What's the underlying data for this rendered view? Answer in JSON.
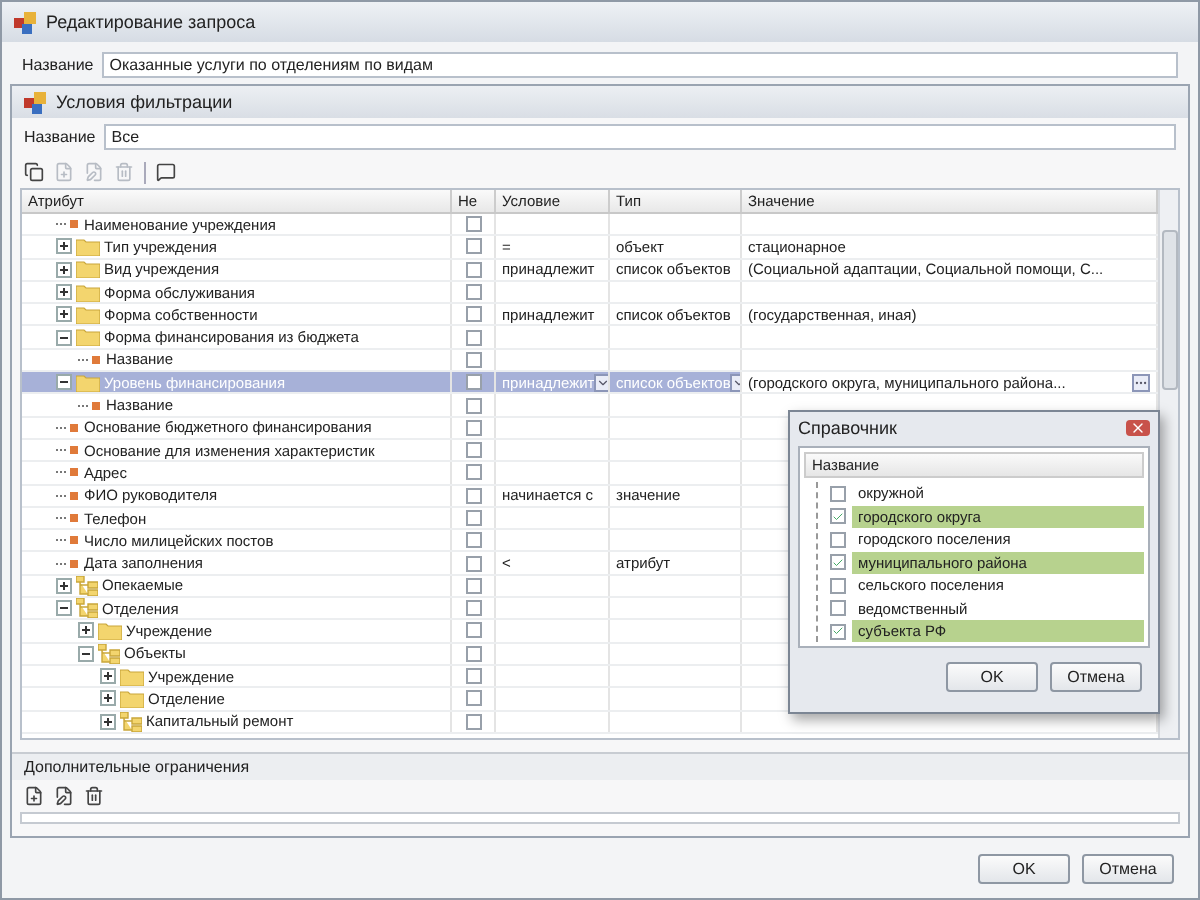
{
  "window": {
    "title": "Редактирование запроса"
  },
  "name_field": {
    "label": "Название",
    "value": "Оказанные услуги по отделениям по видам"
  },
  "filter_window": {
    "title": "Условия фильтрации",
    "name_field": {
      "label": "Название",
      "value": "Все"
    },
    "toolbar": [
      {
        "kind": "copy",
        "disabled": false
      },
      {
        "kind": "add",
        "disabled": true
      },
      {
        "kind": "edit",
        "disabled": true
      },
      {
        "kind": "delete",
        "disabled": true
      },
      {
        "kind": "comment",
        "disabled": false
      }
    ],
    "columns": [
      "Атрибут",
      "Не",
      "Условие",
      "Тип",
      "Значение"
    ],
    "rows": [
      {
        "label": "Наименование учреждения",
        "kind": "leaf",
        "negate": false,
        "selected": false
      },
      {
        "label": "Тип учреждения",
        "kind": "folder",
        "expanded": false,
        "negate": false,
        "selected": false,
        "condition": "=",
        "type": "объект",
        "value": "стационарное"
      },
      {
        "label": "Вид учреждения",
        "kind": "folder",
        "expanded": false,
        "negate": false,
        "selected": false,
        "condition": "принадлежит",
        "type": "список объектов",
        "value": "(Социальной адаптации, Социальной помощи, С..."
      },
      {
        "label": "Форма обслуживания",
        "kind": "folder",
        "expanded": false,
        "negate": false,
        "selected": false
      },
      {
        "label": "Форма собственности",
        "kind": "folder",
        "expanded": false,
        "negate": false,
        "selected": false,
        "condition": "принадлежит",
        "type": "список объектов",
        "value": "(государственная, иная)"
      },
      {
        "label": "Форма финансирования из бюджета",
        "kind": "folder",
        "expanded": true,
        "negate": false,
        "selected": false,
        "children": [
          {
            "label": "Название",
            "kind": "leaf",
            "negate": false,
            "selected": false
          }
        ]
      },
      {
        "label": "Уровень финансирования",
        "kind": "folder",
        "expanded": true,
        "negate": false,
        "selected": true,
        "condition": "принадлежит",
        "type": "список объектов",
        "value": "(городского округа, муниципального района...",
        "children": [
          {
            "label": "Название",
            "kind": "leaf",
            "negate": false,
            "selected": false
          }
        ]
      },
      {
        "label": "Основание бюджетного финансирования",
        "kind": "leaf",
        "negate": false,
        "selected": false
      },
      {
        "label": "Основание для изменения характеристик",
        "kind": "leaf",
        "negate": false,
        "selected": false
      },
      {
        "label": "Адрес",
        "kind": "leaf",
        "negate": false,
        "selected": false
      },
      {
        "label": "ФИО руководителя",
        "kind": "leaf",
        "negate": false,
        "selected": false,
        "condition": "начинается с",
        "type": "значение"
      },
      {
        "label": "Телефон",
        "kind": "leaf",
        "negate": false,
        "selected": false
      },
      {
        "label": "Число милицейских постов",
        "kind": "leaf",
        "negate": false,
        "selected": false
      },
      {
        "label": "Дата заполнения",
        "kind": "leaf",
        "negate": false,
        "selected": false,
        "condition": "<",
        "type": "атрибут"
      },
      {
        "label": "Опекаемые",
        "kind": "group",
        "expanded": false,
        "negate": false,
        "selected": false
      },
      {
        "label": "Отделения",
        "kind": "group",
        "expanded": true,
        "negate": false,
        "selected": false,
        "children": [
          {
            "label": "Учреждение",
            "kind": "folder",
            "expanded": false,
            "negate": false,
            "selected": false
          },
          {
            "label": "Объекты",
            "kind": "group",
            "expanded": true,
            "negate": false,
            "selected": false,
            "children": [
              {
                "label": "Учреждение",
                "kind": "folder",
                "expanded": false,
                "negate": false,
                "selected": false
              },
              {
                "label": "Отделение",
                "kind": "folder",
                "expanded": false,
                "negate": false,
                "selected": false
              },
              {
                "label": "Капитальный ремонт",
                "kind": "group",
                "expanded": false,
                "negate": false,
                "selected": false
              }
            ]
          }
        ]
      }
    ]
  },
  "restrictions": {
    "title": "Дополнительные ограничения",
    "toolbar": [
      {
        "kind": "add"
      },
      {
        "kind": "edit"
      },
      {
        "kind": "delete"
      }
    ]
  },
  "buttons": [
    "OK",
    "Отмена"
  ],
  "dialog": {
    "title": "Справочник",
    "column": "Название",
    "items": [
      {
        "label": "окружной",
        "checked": false
      },
      {
        "label": "городского округа",
        "checked": true
      },
      {
        "label": "городского поселения",
        "checked": false
      },
      {
        "label": "муниципального района",
        "checked": true
      },
      {
        "label": "сельского поселения",
        "checked": false
      },
      {
        "label": "ведомственный",
        "checked": false
      },
      {
        "label": "субъекта РФ",
        "checked": true
      }
    ],
    "buttons": [
      "OK",
      "Отмена"
    ]
  }
}
